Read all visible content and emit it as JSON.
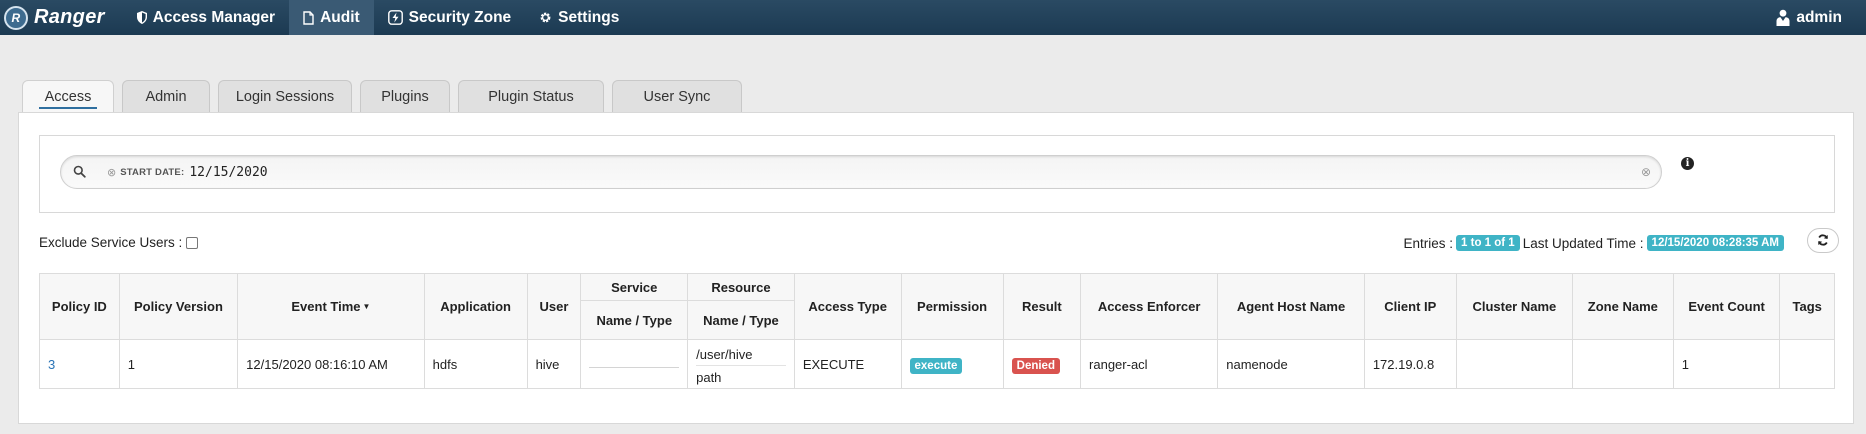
{
  "navbar": {
    "brand": "Ranger",
    "logo_letter": "R",
    "items": [
      {
        "label": "Access Manager",
        "icon": "shield-icon"
      },
      {
        "label": "Audit",
        "icon": "file-icon"
      },
      {
        "label": "Security Zone",
        "icon": "lightning-icon"
      },
      {
        "label": "Settings",
        "icon": "gear-icon"
      }
    ],
    "active_item": "Audit",
    "user": "admin",
    "colors": {
      "bar": "#1c3a52",
      "active": "#3a5a74"
    }
  },
  "tabs": [
    {
      "label": "Access",
      "active": true
    },
    {
      "label": "Admin",
      "active": false
    },
    {
      "label": "Login Sessions",
      "active": false
    },
    {
      "label": "Plugins",
      "active": false
    },
    {
      "label": "Plugin Status",
      "active": false
    },
    {
      "label": "User Sync",
      "active": false
    }
  ],
  "search": {
    "facet_key": "START DATE:",
    "facet_value": "12/15/2020"
  },
  "filters": {
    "exclude_label": "Exclude Service Users :",
    "exclude_checked": false
  },
  "status": {
    "entries_label": "Entries :",
    "entries_value": "1 to 1 of 1",
    "updated_label": "Last Updated Time :",
    "updated_value": "12/15/2020 08:28:35 AM"
  },
  "table": {
    "group_headers": {
      "service": "Service",
      "resource": "Resource"
    },
    "columns": {
      "policy_id": "Policy ID",
      "policy_version": "Policy Version",
      "event_time": "Event Time",
      "application": "Application",
      "user": "User",
      "service_name_type": "Name / Type",
      "resource_name_type": "Name / Type",
      "access_type": "Access Type",
      "permission": "Permission",
      "result": "Result",
      "access_enforcer": "Access Enforcer",
      "agent_host_name": "Agent Host Name",
      "client_ip": "Client IP",
      "cluster_name": "Cluster Name",
      "zone_name": "Zone Name",
      "event_count": "Event Count",
      "tags": "Tags"
    },
    "rows": [
      {
        "policy_id": "3",
        "policy_version": "1",
        "event_time": "12/15/2020 08:16:10 AM",
        "application": "hdfs",
        "user": "hive",
        "service": "",
        "resource_name": "/user/hive",
        "resource_type": "path",
        "access_type": "EXECUTE",
        "permission": "execute",
        "result": "Denied",
        "access_enforcer": "ranger-acl",
        "agent_host_name": "namenode",
        "client_ip": "172.19.0.8",
        "cluster_name": "",
        "zone_name": "",
        "event_count": "1",
        "tags": ""
      }
    ],
    "colors": {
      "link": "#2a74b6",
      "info_badge": "#3fb4c6",
      "denied_badge": "#d9534f"
    }
  }
}
